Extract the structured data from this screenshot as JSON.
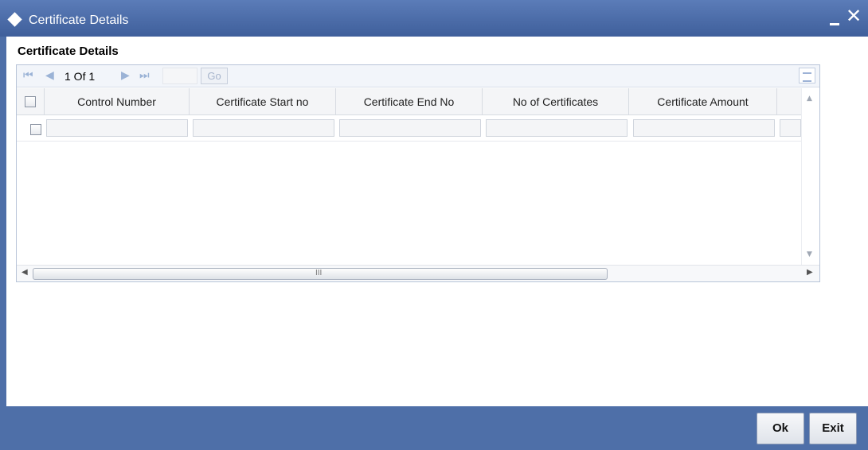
{
  "window": {
    "title": "Certificate Details",
    "close_glyph": "✕",
    "minimize_glyph": "–"
  },
  "section": {
    "title": "Certificate Details"
  },
  "toolbar": {
    "first_icon": "first-page-icon",
    "prev_icon": "prev-page-icon",
    "next_icon": "next-page-icon",
    "last_icon": "last-page-icon",
    "page_info": "1 Of 1",
    "page_input": "",
    "go_label": "Go"
  },
  "grid": {
    "columns": [
      "Control Number",
      "Certificate Start no",
      "Certificate End No",
      "No of Certificates",
      "Certificate Amount"
    ],
    "rows": [
      {
        "values": [
          "",
          "",
          "",
          "",
          "",
          ""
        ]
      }
    ],
    "hscroll_grip": "III"
  },
  "footer": {
    "ok_label": "Ok",
    "exit_label": "Exit"
  },
  "colors": {
    "titlebar": "#4e6fa8",
    "footer": "#4e6fa8"
  }
}
